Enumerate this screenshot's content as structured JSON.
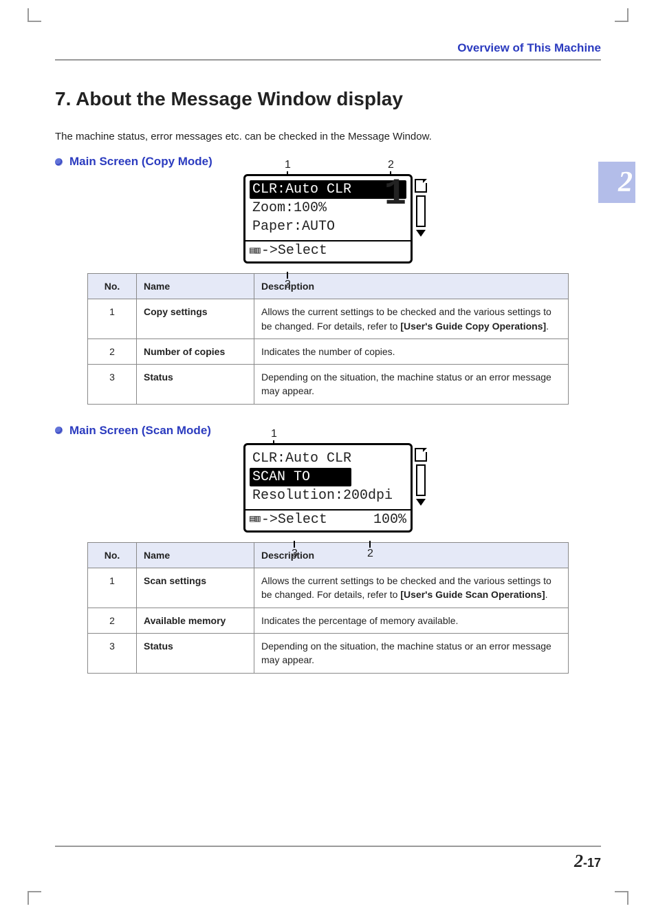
{
  "header": {
    "running_title": "Overview of This Machine",
    "chapter_tab": "2"
  },
  "title": "7. About the Message Window display",
  "intro": "The machine status, error messages etc. can be checked in the Message Window.",
  "copy": {
    "heading": "Main Screen (Copy Mode)",
    "panel": {
      "callout1": "1",
      "callout2": "2",
      "callout3": "3",
      "line1": "CLR:Auto CLR",
      "line2": "Zoom:100%",
      "line3": "Paper:AUTO",
      "status_prefix": "->Select",
      "big_number": "1"
    },
    "table": {
      "head_no": "No.",
      "head_name": "Name",
      "head_desc": "Description",
      "rows": [
        {
          "no": "1",
          "name": "Copy settings",
          "desc_a": "Allows the current settings to be checked and the various settings to be changed. For details, refer to ",
          "desc_bold": "[User's Guide Copy Operations]",
          "desc_b": "."
        },
        {
          "no": "2",
          "name": "Number of copies",
          "desc_a": "Indicates the number of copies.",
          "desc_bold": "",
          "desc_b": ""
        },
        {
          "no": "3",
          "name": "Status",
          "desc_a": "Depending on the situation, the machine status or an error message may appear.",
          "desc_bold": "",
          "desc_b": ""
        }
      ]
    }
  },
  "scan": {
    "heading": "Main Screen (Scan Mode)",
    "panel": {
      "callout1": "1",
      "callout2": "2",
      "callout3": "3",
      "line1": "CLR:Auto CLR",
      "line2": "SCAN TO",
      "line3": "Resolution:200dpi",
      "status_prefix": "->Select",
      "status_right": "100%"
    },
    "table": {
      "head_no": "No.",
      "head_name": "Name",
      "head_desc": "Description",
      "rows": [
        {
          "no": "1",
          "name": "Scan settings",
          "desc_a": "Allows the current settings to be checked and the various settings to be changed. For details, refer to ",
          "desc_bold": "[User's Guide Scan Operations]",
          "desc_b": "."
        },
        {
          "no": "2",
          "name": "Available memory",
          "desc_a": "Indicates the percentage of memory available.",
          "desc_bold": "",
          "desc_b": ""
        },
        {
          "no": "3",
          "name": "Status",
          "desc_a": "Depending on the situation, the machine status or an error message may appear.",
          "desc_bold": "",
          "desc_b": ""
        }
      ]
    }
  },
  "footer": {
    "chapter": "2",
    "sep": "-",
    "page": "17"
  }
}
